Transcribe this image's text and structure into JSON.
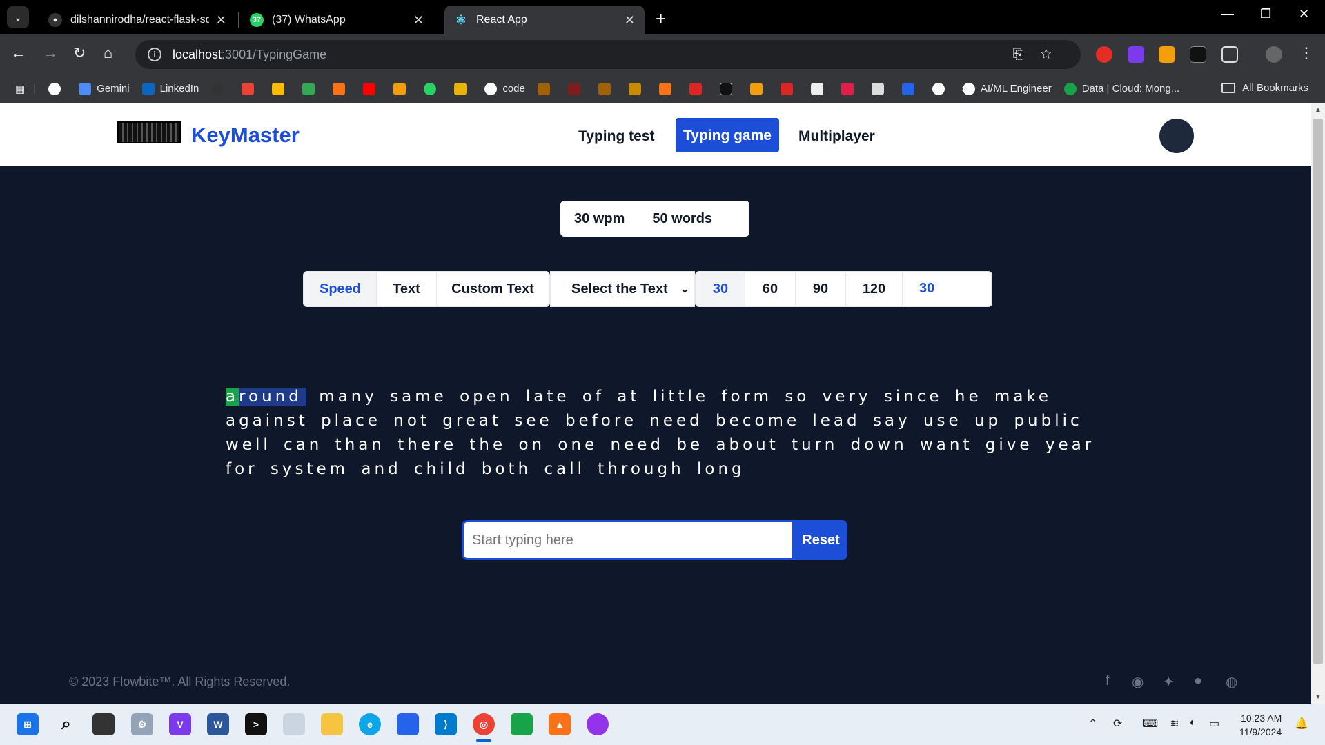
{
  "browser": {
    "tabs": [
      {
        "title": "dilshannirodha/react-flask-sql-c",
        "favicon": "github-icon",
        "active": false
      },
      {
        "title": "(37) WhatsApp",
        "favicon": "whatsapp-icon",
        "active": false
      },
      {
        "title": "React App",
        "favicon": "react-icon",
        "active": true
      }
    ],
    "url_host": "localhost",
    "url_path": ":3001/TypingGame",
    "bookmarks": [
      "Gemini",
      "LinkedIn",
      "code",
      "AI/ML Engineer",
      "Data | Cloud: Mong..."
    ],
    "all_bookmarks": "All Bookmarks",
    "more_bookmarks": "»"
  },
  "app": {
    "brand": "KeyMaster",
    "nav": {
      "typing_test": "Typing test",
      "typing_game": "Typing game",
      "multiplayer": "Multiplayer"
    },
    "stats": {
      "wpm": "30 wpm",
      "words": "50 words"
    },
    "modes": {
      "speed": "Speed",
      "text": "Text",
      "custom_text": "Custom Text"
    },
    "select_text": "Select the Text",
    "durations": [
      "30",
      "60",
      "90",
      "120"
    ],
    "custom_duration": "30",
    "passage_current": "around",
    "passage_rest": "many same open late of at little form so very since he make against place not great see before need become lead say use up public well can than there the on one need be about turn down want give year for system and child both call through long",
    "input_placeholder": "Start typing here",
    "reset_label": "Reset",
    "footer": "© 2023 Flowbite™. All Rights Reserved."
  },
  "taskbar": {
    "time": "10:23 AM",
    "date": "11/9/2024"
  },
  "colors": {
    "primary": "#1d4ed8",
    "page_bg": "#0f172a",
    "current_word_bg": "#1e3a8a",
    "current_char_bg": "#16a34a"
  }
}
